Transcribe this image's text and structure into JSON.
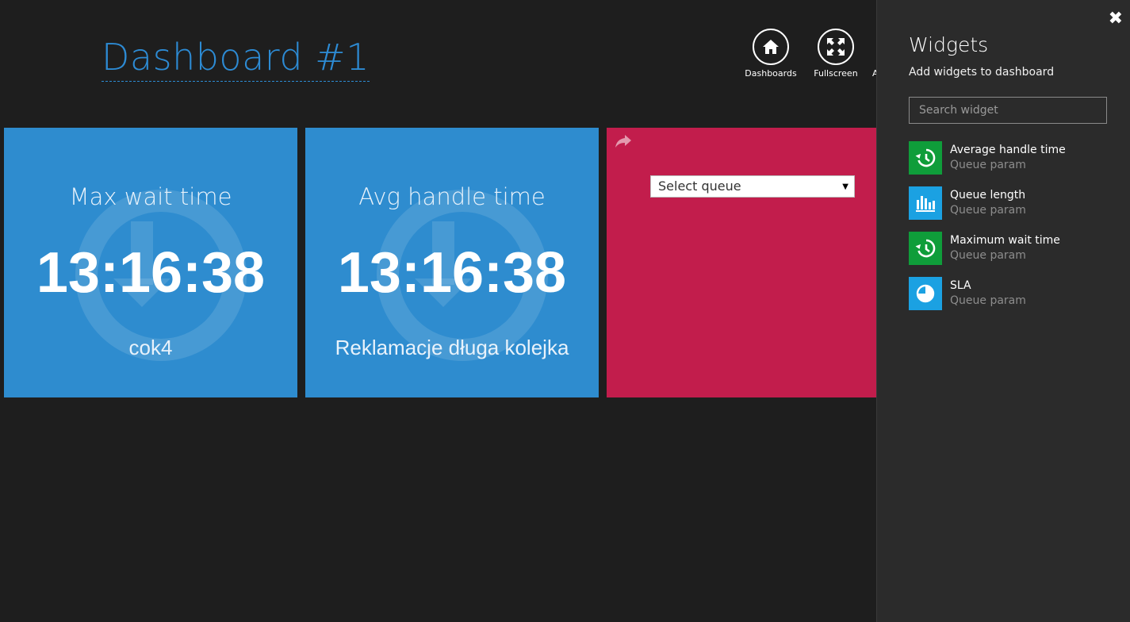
{
  "header": {
    "title": "Dashboard #1",
    "buttons": [
      {
        "label": "Dashboards",
        "icon": "home-icon"
      },
      {
        "label": "Fullscreen",
        "icon": "fullscreen-icon"
      }
    ],
    "partial_label": "A"
  },
  "tiles": [
    {
      "title": "Max wait time",
      "value": "13:16:38",
      "subtitle": "cok4",
      "color": "#2e8ccf",
      "icon": "clock-icon"
    },
    {
      "title": "Avg handle time",
      "value": "13:16:38",
      "subtitle": "Reklamacje długa kolejka",
      "color": "#2e8ccf",
      "icon": "clock-icon"
    },
    {
      "select_value": "Select queue",
      "color": "#c21d4c",
      "icon": "share-icon"
    }
  ],
  "panel": {
    "title": "Widgets",
    "subtitle": "Add widgets to dashboard",
    "search_placeholder": "Search widget",
    "close_icon": "close-icon",
    "widgets": [
      {
        "name": "Average handle time",
        "param": "Queue param",
        "icon": "history-icon",
        "color": "#0f9d3a"
      },
      {
        "name": "Queue length",
        "param": "Queue param",
        "icon": "bar-chart-icon",
        "color": "#1ba1e2"
      },
      {
        "name": "Maximum wait time",
        "param": "Queue param",
        "icon": "history-icon",
        "color": "#0f9d3a"
      },
      {
        "name": "SLA",
        "param": "Queue param",
        "icon": "pie-chart-icon",
        "color": "#1ba1e2"
      }
    ]
  }
}
